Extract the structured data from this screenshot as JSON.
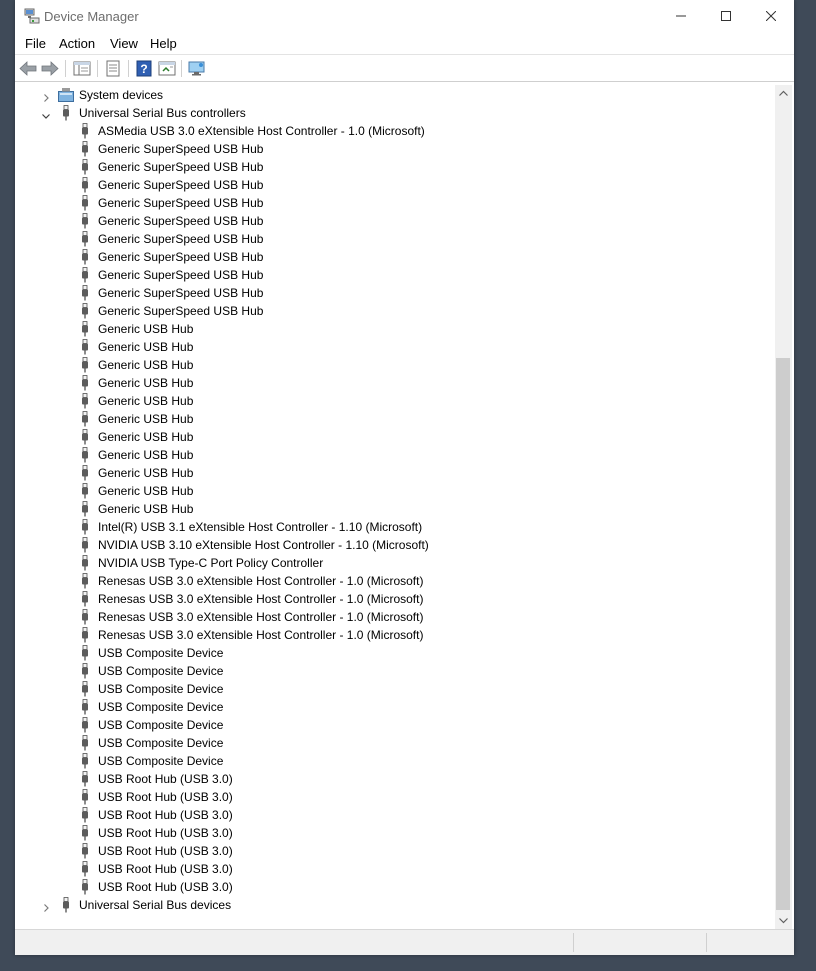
{
  "window": {
    "title": "Device Manager"
  },
  "menu": {
    "items": [
      "File",
      "Action",
      "View",
      "Help"
    ]
  },
  "toolbar": {
    "buttons": [
      "back-arrow-icon",
      "forward-arrow-icon",
      "show-hide-tree-icon",
      "properties-icon",
      "help-icon",
      "update-driver-icon",
      "scan-hardware-icon"
    ]
  },
  "tree": {
    "system_devices": "System devices",
    "usb_controllers": "Universal Serial Bus controllers",
    "usb_devices": "Universal Serial Bus devices",
    "children": [
      "ASMedia USB 3.0 eXtensible Host Controller - 1.0 (Microsoft)",
      "Generic SuperSpeed USB Hub",
      "Generic SuperSpeed USB Hub",
      "Generic SuperSpeed USB Hub",
      "Generic SuperSpeed USB Hub",
      "Generic SuperSpeed USB Hub",
      "Generic SuperSpeed USB Hub",
      "Generic SuperSpeed USB Hub",
      "Generic SuperSpeed USB Hub",
      "Generic SuperSpeed USB Hub",
      "Generic SuperSpeed USB Hub",
      "Generic USB Hub",
      "Generic USB Hub",
      "Generic USB Hub",
      "Generic USB Hub",
      "Generic USB Hub",
      "Generic USB Hub",
      "Generic USB Hub",
      "Generic USB Hub",
      "Generic USB Hub",
      "Generic USB Hub",
      "Generic USB Hub",
      "Intel(R) USB 3.1 eXtensible Host Controller - 1.10 (Microsoft)",
      "NVIDIA USB 3.10 eXtensible Host Controller - 1.10 (Microsoft)",
      "NVIDIA USB Type-C Port Policy Controller",
      "Renesas USB 3.0 eXtensible Host Controller - 1.0 (Microsoft)",
      "Renesas USB 3.0 eXtensible Host Controller - 1.0 (Microsoft)",
      "Renesas USB 3.0 eXtensible Host Controller - 1.0 (Microsoft)",
      "Renesas USB 3.0 eXtensible Host Controller - 1.0 (Microsoft)",
      "USB Composite Device",
      "USB Composite Device",
      "USB Composite Device",
      "USB Composite Device",
      "USB Composite Device",
      "USB Composite Device",
      "USB Composite Device",
      "USB Root Hub (USB 3.0)",
      "USB Root Hub (USB 3.0)",
      "USB Root Hub (USB 3.0)",
      "USB Root Hub (USB 3.0)",
      "USB Root Hub (USB 3.0)",
      "USB Root Hub (USB 3.0)",
      "USB Root Hub (USB 3.0)"
    ]
  },
  "colors": {
    "desktop": "#3f4a58",
    "title_text": "#6d6d6d",
    "scroll_thumb": "#cdcdcd"
  }
}
